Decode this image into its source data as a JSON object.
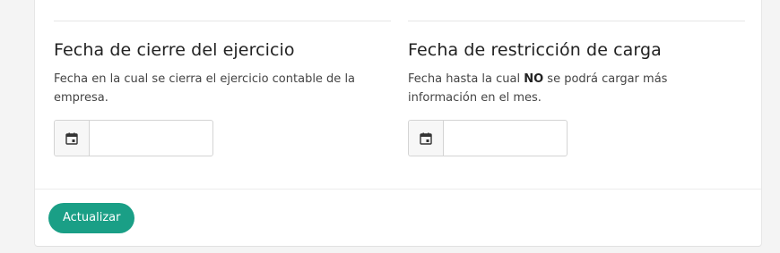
{
  "sections": [
    {
      "title": "Fecha de cierre del ejercicio",
      "description": "Fecha en la cual se cierra el ejercicio contable de la empresa.",
      "date_value": "",
      "icon": "calendar-icon"
    },
    {
      "title": "Fecha de restricción de carga",
      "description_before": "Fecha hasta la cual ",
      "description_strong": "NO",
      "description_after": " se podrá cargar más información en el mes.",
      "date_value": "",
      "icon": "calendar-icon"
    }
  ],
  "footer": {
    "update_label": "Actualizar"
  },
  "colors": {
    "primary": "#1a9f86",
    "border": "#d4d4d4",
    "addon_bg": "#f7f7f7",
    "page_bg": "#f4f4f4"
  }
}
